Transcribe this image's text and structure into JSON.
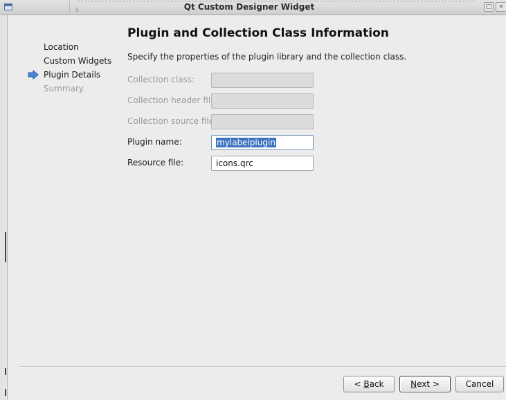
{
  "window": {
    "title": "Qt Custom Designer Widget",
    "editor_line_number": "6"
  },
  "nav": {
    "items": [
      {
        "label": "Location",
        "state": "done"
      },
      {
        "label": "Custom Widgets",
        "state": "done"
      },
      {
        "label": "Plugin Details",
        "state": "current"
      },
      {
        "label": "Summary",
        "state": "future"
      }
    ]
  },
  "page": {
    "heading": "Plugin and Collection Class Information",
    "description": "Specify the properties of the plugin library and the collection class."
  },
  "form": {
    "collection_class": {
      "label": "Collection class:",
      "value": ""
    },
    "collection_header": {
      "label": "Collection header file:",
      "value": ""
    },
    "collection_source": {
      "label": "Collection source file:",
      "value": ""
    },
    "plugin_name": {
      "label": "Plugin name:",
      "value": "mylabelplugin"
    },
    "resource_file": {
      "label": "Resource file:",
      "value": "icons.qrc"
    }
  },
  "buttons": {
    "back_prefix": "< ",
    "back_mnemonic": "B",
    "back_rest": "ack",
    "next_mnemonic": "N",
    "next_rest": "ext >",
    "cancel": "Cancel"
  },
  "colors": {
    "selection": "#3b73c2",
    "nav_arrow": "#4a86d4"
  }
}
